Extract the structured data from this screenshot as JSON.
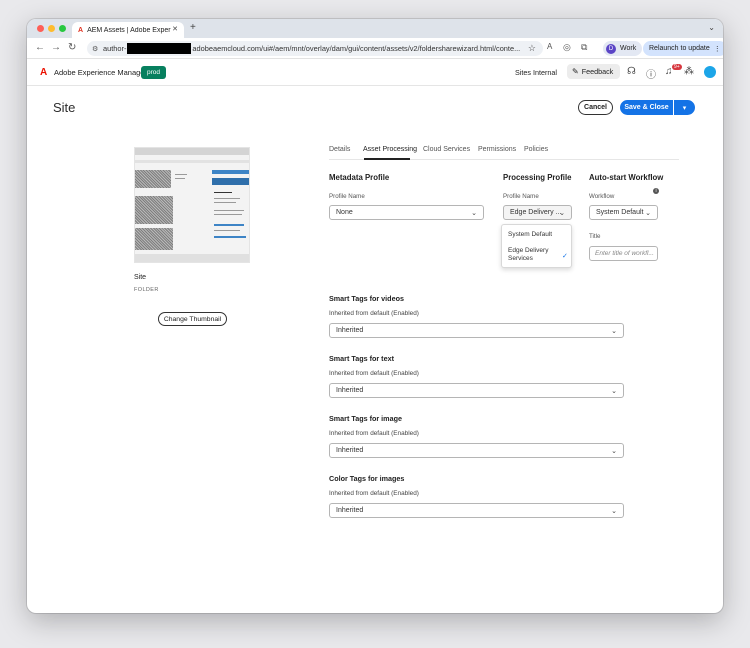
{
  "browser": {
    "tab_title": "AEM Assets | Adobe Experien",
    "url_prefix": "author-",
    "url_rest": "adobeaemcloud.com/ui#/aem/mnt/overlay/dam/gui/content/assets/v2/foldersharewizard.html/conte...",
    "profile_label": "Work",
    "profile_initial": "D",
    "relaunch_label": "Relaunch to update"
  },
  "header": {
    "app_name": "Adobe Experience Manager",
    "env_badge": "prod",
    "workspace": "Sites Internal",
    "feedback_label": "Feedback",
    "notification_count": "9+"
  },
  "page": {
    "title": "Site",
    "cancel_label": "Cancel",
    "save_label": "Save & Close"
  },
  "thumbnail": {
    "name": "Site",
    "type": "FOLDER",
    "change_label": "Change Thumbnail"
  },
  "tabs": [
    "Details",
    "Asset Processing",
    "Cloud Services",
    "Permissions",
    "Policies"
  ],
  "active_tab": "Asset Processing",
  "metadata_profile": {
    "heading": "Metadata Profile",
    "field_label": "Profile Name",
    "value": "None"
  },
  "processing_profile": {
    "heading": "Processing Profile",
    "field_label": "Profile Name",
    "value": "Edge Delivery ...",
    "options": [
      "System Default",
      "Edge Delivery",
      "Services"
    ]
  },
  "workflow": {
    "heading": "Auto-start Workflow",
    "field_label": "Workflow",
    "value": "System Default",
    "title_label": "Title",
    "title_placeholder": "Enter title of workfl..."
  },
  "smart_tags": [
    {
      "heading": "Smart Tags for videos",
      "note": "Inherited from default (Enabled)",
      "value": "Inherited"
    },
    {
      "heading": "Smart Tags for text",
      "note": "Inherited from default (Enabled)",
      "value": "Inherited"
    },
    {
      "heading": "Smart Tags for image",
      "note": "Inherited from default (Enabled)",
      "value": "Inherited"
    },
    {
      "heading": "Color Tags for images",
      "note": "Inherited from default (Enabled)",
      "value": "Inherited"
    }
  ],
  "colors": {
    "accent": "#1473e6",
    "brand": "#eb1000",
    "env_badge": "#07805f"
  }
}
